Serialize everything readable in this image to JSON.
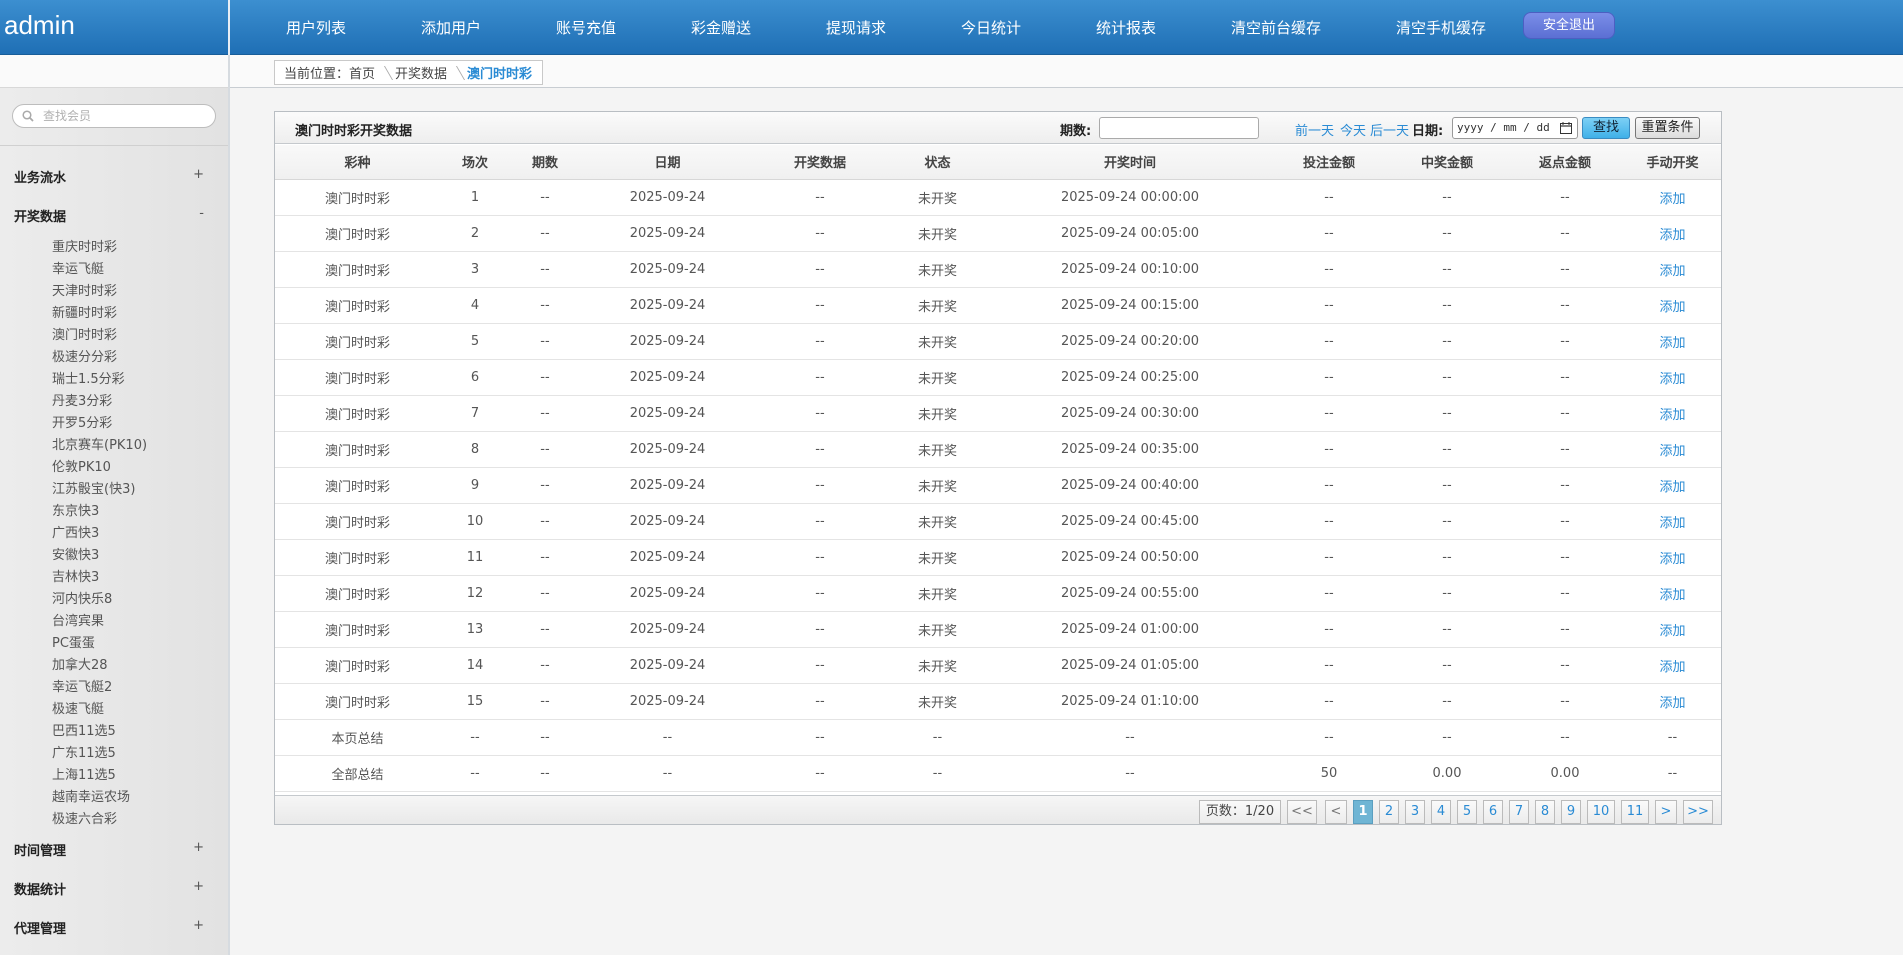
{
  "header": {
    "brand": "admin",
    "nav": [
      {
        "label": "用户列表"
      },
      {
        "label": "添加用户"
      },
      {
        "label": "账号充值"
      },
      {
        "label": "彩金赠送"
      },
      {
        "label": "提现请求"
      },
      {
        "label": "今日统计"
      },
      {
        "label": "统计报表"
      },
      {
        "label": "清空前台缓存"
      },
      {
        "label": "清空手机缓存"
      }
    ],
    "logout_label": "安全退出"
  },
  "breadcrumb": {
    "prefix": "当前位置：",
    "items": [
      "首页",
      "开奖数据"
    ],
    "current": "澳门时时彩"
  },
  "sidebar": {
    "search_placeholder": "查找会员",
    "groups": [
      {
        "label": "业务流水",
        "toggle": "+"
      },
      {
        "label": "开奖数据",
        "toggle": "-"
      },
      {
        "label": "时间管理",
        "toggle": "+"
      },
      {
        "label": "数据统计",
        "toggle": "+"
      },
      {
        "label": "代理管理",
        "toggle": "+"
      }
    ],
    "lottery_items": [
      "重庆时时彩",
      "幸运飞艇",
      "天津时时彩",
      "新疆时时彩",
      "澳门时时彩",
      "极速分分彩",
      "瑞士1.5分彩",
      "丹麦3分彩",
      "开罗5分彩",
      "北京赛车(PK10)",
      "伦敦PK10",
      "江苏骰宝(快3)",
      "东京快3",
      "广西快3",
      "安徽快3",
      "吉林快3",
      "河内快乐8",
      "台湾宾果",
      "PC蛋蛋",
      "加拿大28",
      "幸运飞艇2",
      "极速飞艇",
      "巴西11选5",
      "广东11选5",
      "上海11选5",
      "越南幸运农场",
      "极速六合彩"
    ]
  },
  "panel": {
    "title": "澳门时时彩开奖数据",
    "issue_label": "期数:",
    "quick_prev": "前一天",
    "quick_today": "今天",
    "quick_next": "后一天",
    "date_label": "日期:",
    "date_placeholder": "yyyy / mm / dd",
    "find_label": "查找",
    "reset_label": "重置条件"
  },
  "table": {
    "columns": [
      "彩种",
      "场次",
      "期数",
      "日期",
      "开奖数据",
      "状态",
      "开奖时间",
      "投注金额",
      "中奖金额",
      "返点金额",
      "手动开奖"
    ],
    "rows": [
      [
        "澳门时时彩",
        "1",
        "--",
        "2025-09-24",
        "--",
        "未开奖",
        "2025-09-24 00:00:00",
        "--",
        "--",
        "--",
        "添加"
      ],
      [
        "澳门时时彩",
        "2",
        "--",
        "2025-09-24",
        "--",
        "未开奖",
        "2025-09-24 00:05:00",
        "--",
        "--",
        "--",
        "添加"
      ],
      [
        "澳门时时彩",
        "3",
        "--",
        "2025-09-24",
        "--",
        "未开奖",
        "2025-09-24 00:10:00",
        "--",
        "--",
        "--",
        "添加"
      ],
      [
        "澳门时时彩",
        "4",
        "--",
        "2025-09-24",
        "--",
        "未开奖",
        "2025-09-24 00:15:00",
        "--",
        "--",
        "--",
        "添加"
      ],
      [
        "澳门时时彩",
        "5",
        "--",
        "2025-09-24",
        "--",
        "未开奖",
        "2025-09-24 00:20:00",
        "--",
        "--",
        "--",
        "添加"
      ],
      [
        "澳门时时彩",
        "6",
        "--",
        "2025-09-24",
        "--",
        "未开奖",
        "2025-09-24 00:25:00",
        "--",
        "--",
        "--",
        "添加"
      ],
      [
        "澳门时时彩",
        "7",
        "--",
        "2025-09-24",
        "--",
        "未开奖",
        "2025-09-24 00:30:00",
        "--",
        "--",
        "--",
        "添加"
      ],
      [
        "澳门时时彩",
        "8",
        "--",
        "2025-09-24",
        "--",
        "未开奖",
        "2025-09-24 00:35:00",
        "--",
        "--",
        "--",
        "添加"
      ],
      [
        "澳门时时彩",
        "9",
        "--",
        "2025-09-24",
        "--",
        "未开奖",
        "2025-09-24 00:40:00",
        "--",
        "--",
        "--",
        "添加"
      ],
      [
        "澳门时时彩",
        "10",
        "--",
        "2025-09-24",
        "--",
        "未开奖",
        "2025-09-24 00:45:00",
        "--",
        "--",
        "--",
        "添加"
      ],
      [
        "澳门时时彩",
        "11",
        "--",
        "2025-09-24",
        "--",
        "未开奖",
        "2025-09-24 00:50:00",
        "--",
        "--",
        "--",
        "添加"
      ],
      [
        "澳门时时彩",
        "12",
        "--",
        "2025-09-24",
        "--",
        "未开奖",
        "2025-09-24 00:55:00",
        "--",
        "--",
        "--",
        "添加"
      ],
      [
        "澳门时时彩",
        "13",
        "--",
        "2025-09-24",
        "--",
        "未开奖",
        "2025-09-24 01:00:00",
        "--",
        "--",
        "--",
        "添加"
      ],
      [
        "澳门时时彩",
        "14",
        "--",
        "2025-09-24",
        "--",
        "未开奖",
        "2025-09-24 01:05:00",
        "--",
        "--",
        "--",
        "添加"
      ],
      [
        "澳门时时彩",
        "15",
        "--",
        "2025-09-24",
        "--",
        "未开奖",
        "2025-09-24 01:10:00",
        "--",
        "--",
        "--",
        "添加"
      ]
    ],
    "page_summary": [
      "本页总结",
      "--",
      "--",
      "--",
      "--",
      "--",
      "--",
      "--",
      "--",
      "--",
      "--"
    ],
    "total_summary": [
      "全部总结",
      "--",
      "--",
      "--",
      "--",
      "--",
      "--",
      "50",
      "0.00",
      "0.00",
      "--"
    ]
  },
  "pager": {
    "info": "页数：1/20",
    "first": "<<",
    "prev": "<",
    "pages": [
      "1",
      "2",
      "3",
      "4",
      "5",
      "6",
      "7",
      "8",
      "9",
      "10",
      "11"
    ],
    "active": "1",
    "next": ">",
    "last": ">>"
  },
  "colors": {
    "header": "#1f6fb5",
    "accent_link": "#2a8bd4",
    "logout": "#6b7fe0"
  }
}
